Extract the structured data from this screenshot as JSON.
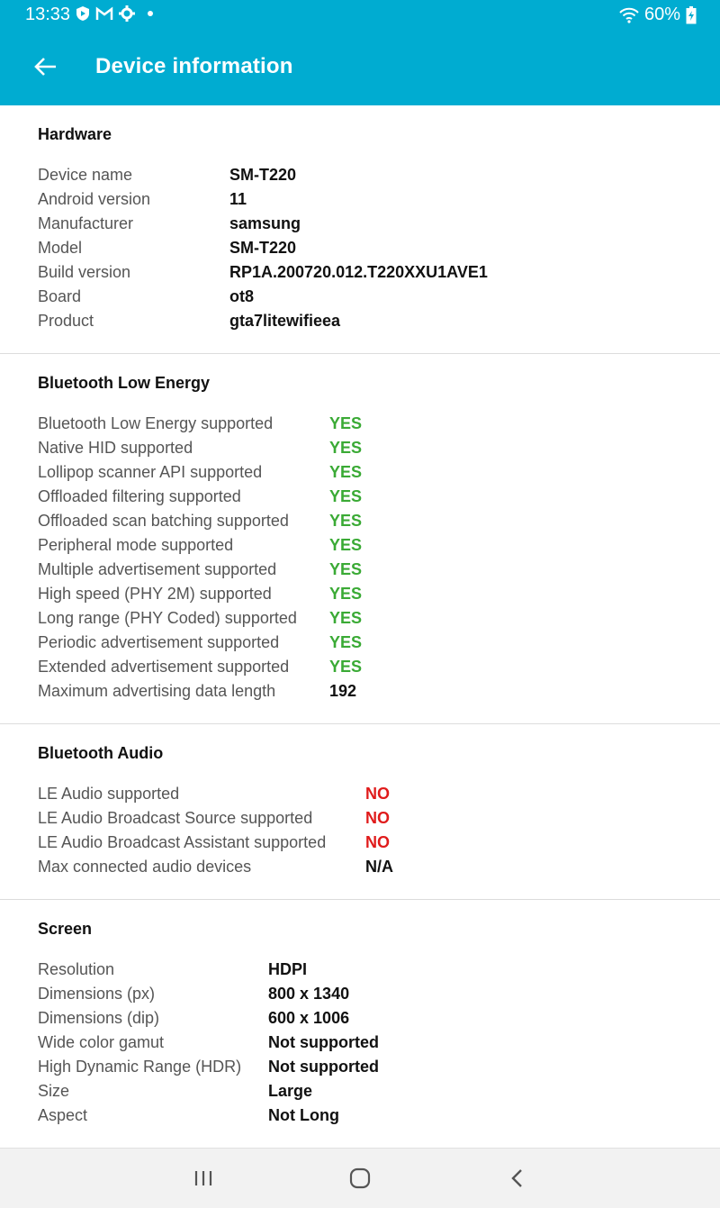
{
  "status_bar": {
    "time": "13:33",
    "battery": "60%"
  },
  "app_bar": {
    "title": "Device information"
  },
  "sections": [
    {
      "title": "Hardware",
      "rows": [
        {
          "label": "Device name",
          "value": "SM-T220"
        },
        {
          "label": "Android version",
          "value": "11"
        },
        {
          "label": "Manufacturer",
          "value": "samsung"
        },
        {
          "label": "Model",
          "value": "SM-T220"
        },
        {
          "label": "Build version",
          "value": "RP1A.200720.012.T220XXU1AVE1"
        },
        {
          "label": "Board",
          "value": "ot8"
        },
        {
          "label": "Product",
          "value": "gta7litewifieea"
        }
      ]
    },
    {
      "title": "Bluetooth Low Energy",
      "rows": [
        {
          "label": "Bluetooth Low Energy supported",
          "value": "YES"
        },
        {
          "label": "Native HID supported",
          "value": "YES"
        },
        {
          "label": "Lollipop scanner API supported",
          "value": "YES"
        },
        {
          "label": "Offloaded filtering supported",
          "value": "YES"
        },
        {
          "label": "Offloaded scan batching supported",
          "value": "YES"
        },
        {
          "label": "Peripheral mode supported",
          "value": "YES"
        },
        {
          "label": "Multiple advertisement supported",
          "value": "YES"
        },
        {
          "label": "High speed (PHY 2M) supported",
          "value": "YES"
        },
        {
          "label": "Long range (PHY Coded) supported",
          "value": "YES"
        },
        {
          "label": "Periodic advertisement supported",
          "value": "YES"
        },
        {
          "label": "Extended advertisement supported",
          "value": "YES"
        },
        {
          "label": "Maximum advertising data length",
          "value": "192"
        }
      ]
    },
    {
      "title": "Bluetooth Audio",
      "rows": [
        {
          "label": "LE Audio supported",
          "value": "NO"
        },
        {
          "label": "LE Audio Broadcast Source supported",
          "value": "NO"
        },
        {
          "label": "LE Audio Broadcast Assistant supported",
          "value": "NO"
        },
        {
          "label": "Max connected audio devices",
          "value": "N/A"
        }
      ]
    },
    {
      "title": "Screen",
      "rows": [
        {
          "label": "Resolution",
          "value": "HDPI"
        },
        {
          "label": "Dimensions (px)",
          "value": "800 x 1340"
        },
        {
          "label": "Dimensions (dip)",
          "value": "600 x 1006"
        },
        {
          "label": "Wide color gamut",
          "value": "Not supported"
        },
        {
          "label": "High Dynamic Range (HDR)",
          "value": "Not supported"
        },
        {
          "label": "Size",
          "value": "Large"
        },
        {
          "label": "Aspect",
          "value": "Not Long"
        }
      ]
    }
  ],
  "colors": {
    "accent": "#00acd1",
    "yes": "#3aaa35",
    "no": "#e01b1b"
  }
}
